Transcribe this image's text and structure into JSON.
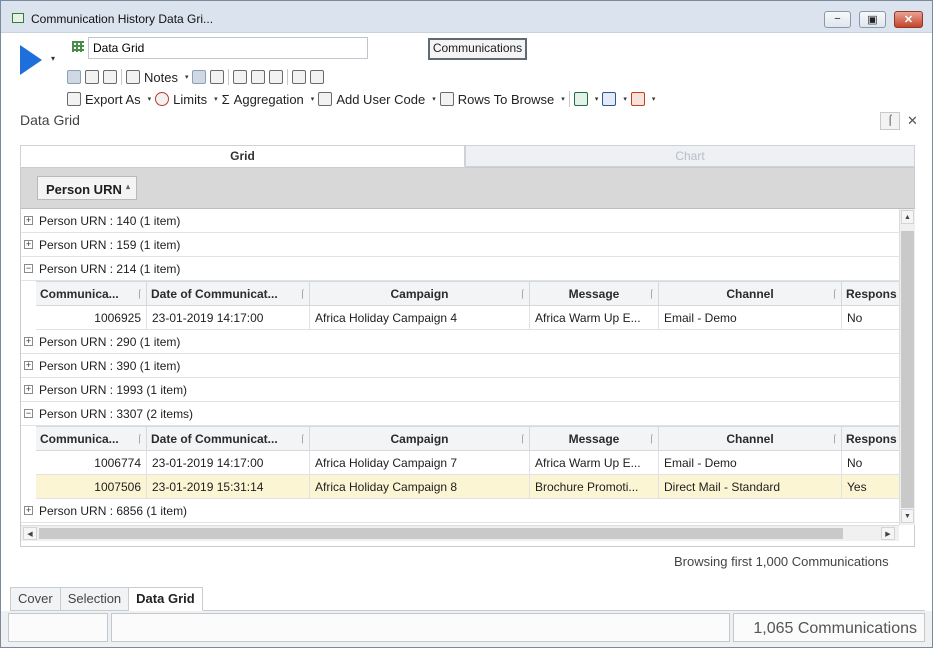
{
  "window": {
    "title": "Communication History Data Gri...",
    "controls": [
      "minimize-icon",
      "maximize-icon",
      "close-icon"
    ],
    "control_glyphs": {
      "minimize": "−",
      "maximize": "▣",
      "close": "✕"
    }
  },
  "top": {
    "name_value": "Data Grid",
    "entity_button": "Communications"
  },
  "toolbar": {
    "notes_label": "Notes",
    "export_label": "Export As",
    "limits_label": "Limits",
    "aggregation_label": "Aggregation",
    "aggregation_glyph": "Σ",
    "add_user_code_label": "Add User Code",
    "rows_to_browse_label": "Rows To Browse",
    "caret": "▾"
  },
  "panel": {
    "title": "Data Grid",
    "pin_glyph": "⌠",
    "close_glyph": "✕",
    "tabs": [
      {
        "label": "Grid",
        "active": true
      },
      {
        "label": "Chart",
        "active": false
      }
    ]
  },
  "grid": {
    "group_by_label": "Person URN",
    "sort_glyph": "▴",
    "collapsed_glyph": "+",
    "expanded_glyph": "−",
    "pin_glyph": "⌠",
    "columns": [
      {
        "label": "Communica...",
        "pinned": true
      },
      {
        "label": "Date of Communicat...",
        "pinned": true
      },
      {
        "label": "Campaign",
        "pinned": true
      },
      {
        "label": "Message",
        "pinned": true
      },
      {
        "label": "Channel",
        "pinned": true
      },
      {
        "label": "Respons",
        "pinned": false
      }
    ],
    "groups": [
      {
        "label": "Person URN : 140 (1 item)",
        "expanded": false,
        "rows": []
      },
      {
        "label": "Person URN : 159 (1 item)",
        "expanded": false,
        "rows": []
      },
      {
        "label": "Person URN : 214 (1 item)",
        "expanded": true,
        "rows": [
          {
            "id": "1006925",
            "date": "23-01-2019 14:17:00",
            "campaign": "Africa Holiday Campaign 4",
            "message": "Africa Warm Up E...",
            "channel": "Email - Demo",
            "response": "No",
            "highlight": false
          }
        ]
      },
      {
        "label": "Person URN : 290 (1 item)",
        "expanded": false,
        "rows": []
      },
      {
        "label": "Person URN : 390 (1 item)",
        "expanded": false,
        "rows": []
      },
      {
        "label": "Person URN : 1993 (1 item)",
        "expanded": false,
        "rows": []
      },
      {
        "label": "Person URN : 3307 (2 items)",
        "expanded": true,
        "rows": [
          {
            "id": "1006774",
            "date": "23-01-2019 14:17:00",
            "campaign": "Africa Holiday Campaign 7",
            "message": "Africa Warm Up E...",
            "channel": "Email - Demo",
            "response": "No",
            "highlight": false
          },
          {
            "id": "1007506",
            "date": "23-01-2019 15:31:14",
            "campaign": "Africa Holiday Campaign 8",
            "message": "Brochure Promoti...",
            "channel": "Direct Mail - Standard",
            "response": "Yes",
            "highlight": true
          }
        ]
      },
      {
        "label": "Person URN : 6856 (1 item)",
        "expanded": false,
        "rows": []
      }
    ],
    "scroll_glyphs": {
      "up": "▲",
      "down": "▼",
      "left": "◀",
      "right": "▶"
    }
  },
  "browse_status": "Browsing first 1,000 Communications",
  "bottom_tabs": [
    {
      "label": "Cover",
      "active": false
    },
    {
      "label": "Selection",
      "active": false
    },
    {
      "label": "Data Grid",
      "active": true
    }
  ],
  "statusbar": {
    "count_text": "1,065 Communications"
  }
}
